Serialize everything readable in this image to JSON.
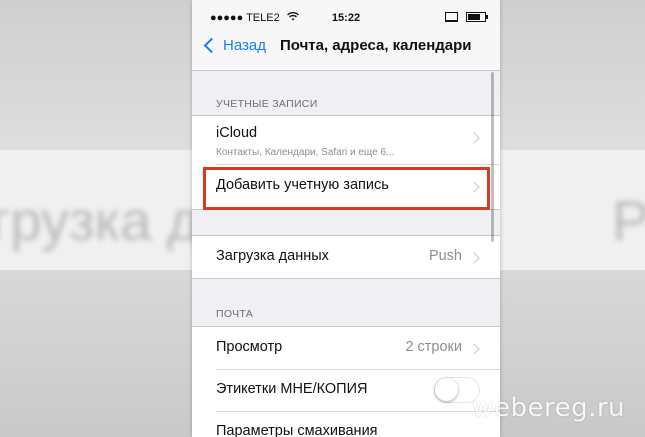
{
  "status_bar": {
    "carrier": "●●●●● TELE2",
    "time": "15:22",
    "wifi_icon": "wifi-icon",
    "battery_icon": "battery-icon"
  },
  "nav": {
    "back_label": "Назад",
    "title": "Почта, адреса, календари"
  },
  "accounts_section": {
    "header": "УЧЕТНЫЕ ЗАПИСИ",
    "items": [
      {
        "title": "iCloud",
        "subtitle": "Контакты, Календари, Safari и еще 6..."
      },
      {
        "title": "Добавить учетную запись"
      }
    ]
  },
  "fetch_section": {
    "items": [
      {
        "title": "Загрузка данных",
        "value": "Push"
      }
    ]
  },
  "mail_section": {
    "header": "ПОЧТА",
    "items": [
      {
        "title": "Просмотр",
        "value": "2 строки"
      },
      {
        "title": "Этикетки МНЕ/КОПИЯ",
        "toggle_on": false
      },
      {
        "title": "Параметры смахивания"
      }
    ]
  },
  "background_text": {
    "left": "грузка д",
    "right": "P"
  },
  "watermark": "webereg.ru",
  "colors": {
    "accent": "#157efb",
    "highlight": "#d9391f"
  }
}
